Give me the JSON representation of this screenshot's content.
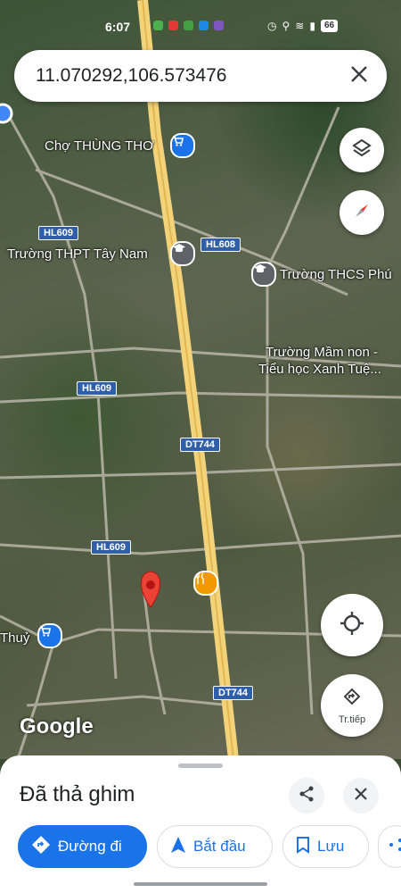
{
  "status_bar": {
    "time": "6:07",
    "battery": "66"
  },
  "search": {
    "query": "11.070292,106.573476",
    "close_icon": "close-icon"
  },
  "map": {
    "places": [
      {
        "name": "Chợ THÙNG THƠ",
        "icon": "shopping-cart-icon",
        "color": "#1a73e8"
      },
      {
        "name": "Trường THPT Tây Nam",
        "icon": "school-icon",
        "color": "#5f6368"
      },
      {
        "name": "Trường THCS Phú",
        "icon": "school-icon",
        "color": "#5f6368"
      },
      {
        "name": "Trường Mầm non -",
        "icon": "",
        "color": ""
      },
      {
        "name": "Tiểu học Xanh Tuệ...",
        "icon": "",
        "color": ""
      },
      {
        "name": "Thuỷ",
        "icon": "shopping-cart-icon",
        "color": "#1a73e8"
      }
    ],
    "road_labels": [
      "HL609",
      "HL608",
      "HL609",
      "DT744",
      "HL609",
      "DT744"
    ],
    "attribution": "Google",
    "buttons": {
      "layers_icon": "layers-icon",
      "compass_icon": "compass-icon",
      "mylocation_icon": "my-location-icon",
      "navigate_label": "Tr.tiếp"
    }
  },
  "sheet": {
    "title": "Đã thả ghim",
    "share_icon": "share-icon",
    "close_icon": "close-icon",
    "actions": [
      {
        "label": "Đường đi",
        "icon": "directions-icon"
      },
      {
        "label": "Bắt đầu",
        "icon": "navigation-arrow-icon"
      },
      {
        "label": "Lưu",
        "icon": "bookmark-icon"
      }
    ]
  }
}
